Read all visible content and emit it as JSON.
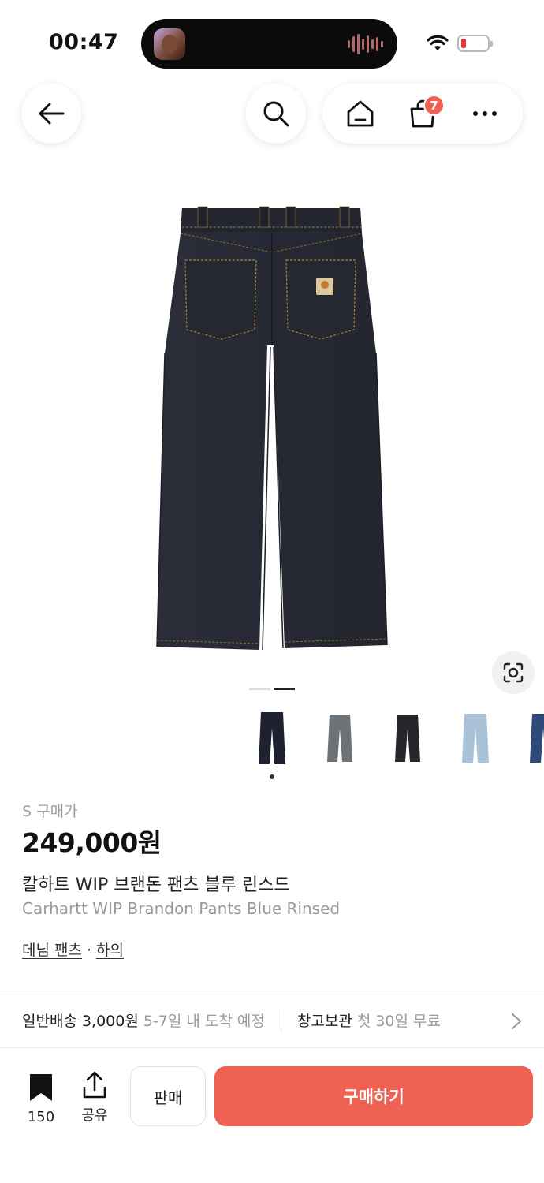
{
  "status_bar": {
    "time": "00:47"
  },
  "nav": {
    "cart_count": "7"
  },
  "product": {
    "size_label": "S 구매가",
    "price": "249,000원",
    "name_ko": "칼하트 WIP 브랜돈 팬츠 블루 린스드",
    "name_en": "Carhartt WIP Brandon Pants Blue Rinsed",
    "category": {
      "primary": "데님 팬츠",
      "separator": "·",
      "secondary": "하의"
    }
  },
  "thumbnails": [
    {
      "name": "thumb-dark-rinsed",
      "color": "#1e2230"
    },
    {
      "name": "thumb-faded-vintage",
      "color": "#6c7378"
    },
    {
      "name": "thumb-black",
      "color": "#25262c"
    },
    {
      "name": "thumb-light-blue",
      "color": "#a9c2d8"
    },
    {
      "name": "thumb-blue",
      "color": "#2d4a78"
    }
  ],
  "shipping": {
    "standard_label": "일반배송 3,000원",
    "standard_eta": "5-7일 내 도착 예정",
    "storage_label": "창고보관",
    "storage_note": "첫 30일 무료"
  },
  "bottom_bar": {
    "bookmark_count": "150",
    "share_label": "공유",
    "sell_label": "판매",
    "buy_label": "구매하기"
  },
  "colors": {
    "accent": "#ef6253",
    "denim": "#272a33",
    "stitch": "#b08a3c"
  }
}
